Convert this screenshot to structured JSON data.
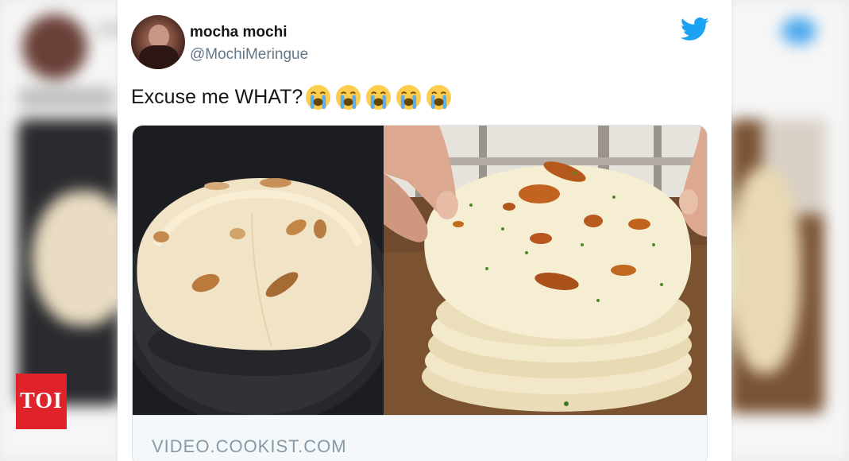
{
  "tweet": {
    "display_name": "mocha mochi",
    "handle": "@MochiMeringue",
    "text": "Excuse me WHAT?",
    "emoji_count": 5,
    "emoji_name": "loudly-crying-face"
  },
  "link_card": {
    "domain": "VIDEO.COOKIST.COM"
  },
  "brand": {
    "logo_text": "TOI",
    "logo_color": "#e0232b",
    "twitter_color": "#1da1f2"
  }
}
